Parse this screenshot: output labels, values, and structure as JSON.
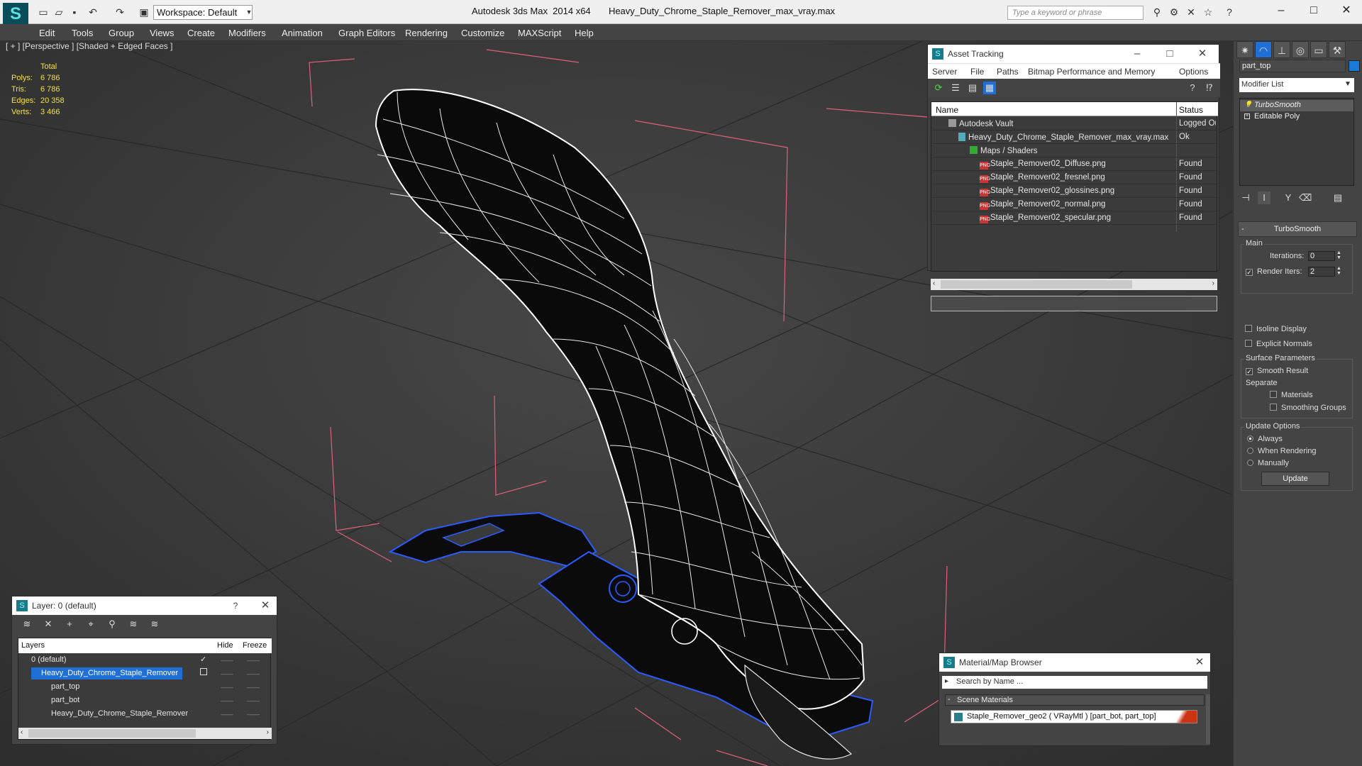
{
  "titlebar": {
    "app_title": "Autodesk 3ds Max  2014 x64       Heavy_Duty_Chrome_Staple_Remover_max_vray.max",
    "workspace": "Workspace: Default",
    "search_placeholder": "Type a keyword or phrase"
  },
  "menubar": [
    "Edit",
    "Tools",
    "Group",
    "Views",
    "Create",
    "Modifiers",
    "Animation",
    "Graph Editors",
    "Rendering",
    "Customize",
    "MAXScript",
    "Help"
  ],
  "viewport": {
    "label": "[ + ] [Perspective ] [Shaded + Edged Faces ]",
    "stats": {
      "total_label": "Total",
      "rows": [
        {
          "label": "Polys:",
          "value": "6 786"
        },
        {
          "label": "Tris:",
          "value": "6 786"
        },
        {
          "label": "Edges:",
          "value": "20 358"
        },
        {
          "label": "Verts:",
          "value": "3 466"
        }
      ]
    }
  },
  "asset_tracking": {
    "title": "Asset Tracking",
    "menu": [
      "Server",
      "File",
      "Paths",
      "Bitmap Performance and Memory",
      "Options"
    ],
    "columns": {
      "name": "Name",
      "status": "Status"
    },
    "rows": [
      {
        "name": "Autodesk Vault",
        "status": "Logged Out",
        "icon": "vault-icon"
      },
      {
        "name": "Heavy_Duty_Chrome_Staple_Remover_max_vray.max",
        "status": "Ok",
        "icon": "max-file-icon"
      },
      {
        "name": "Maps / Shaders",
        "status": "",
        "icon": "maps-icon"
      },
      {
        "name": "Staple_Remover02_Diffuse.png",
        "status": "Found",
        "icon": "png-icon"
      },
      {
        "name": "Staple_Remover02_fresnel.png",
        "status": "Found",
        "icon": "png-icon"
      },
      {
        "name": "Staple_Remover02_glossines.png",
        "status": "Found",
        "icon": "png-icon"
      },
      {
        "name": "Staple_Remover02_normal.png",
        "status": "Found",
        "icon": "png-icon"
      },
      {
        "name": "Staple_Remover02_specular.png",
        "status": "Found",
        "icon": "png-icon"
      }
    ]
  },
  "layer_dialog": {
    "title": "Layer: 0 (default)",
    "help": "?",
    "columns": {
      "layers": "Layers",
      "hide": "Hide",
      "freeze": "Freeze"
    },
    "rows": [
      {
        "name": "0 (default)",
        "selected": false
      },
      {
        "name": "Heavy_Duty_Chrome_Staple_Remover",
        "selected": true
      },
      {
        "name": "part_top",
        "selected": false
      },
      {
        "name": "part_bot",
        "selected": false
      },
      {
        "name": "Heavy_Duty_Chrome_Staple_Remover",
        "selected": false
      }
    ]
  },
  "material_browser": {
    "title": "Material/Map Browser",
    "search_placeholder": "Search by Name ...",
    "group": "Scene Materials",
    "item": "Staple_Remover_geo2  ( VRayMtl ) [part_bot, part_top]"
  },
  "command_panel": {
    "object_name": "part_top",
    "object_color": "#1a7ad6",
    "modifier_list": "Modifier List",
    "stack": [
      "TurboSmooth",
      "Editable Poly"
    ],
    "rollout_title": "TurboSmooth",
    "main_group": "Main",
    "iterations_label": "Iterations:",
    "iterations_value": "0",
    "render_iters_label": "Render Iters:",
    "render_iters_value": "2",
    "isoline_display": "Isoline Display",
    "explicit_normals": "Explicit Normals",
    "surface_params_group": "Surface Parameters",
    "smooth_result": "Smooth Result",
    "separate_label": "Separate",
    "materials": "Materials",
    "smoothing_groups": "Smoothing Groups",
    "update_options_group": "Update Options",
    "always": "Always",
    "when_rendering": "When Rendering",
    "manually": "Manually",
    "update_button": "Update"
  },
  "colors": {
    "accent": "#1f6fd6",
    "stats_text": "#f5e13a",
    "bbox_lines": "#e0607a",
    "wire_selected": "#2a5cff"
  }
}
